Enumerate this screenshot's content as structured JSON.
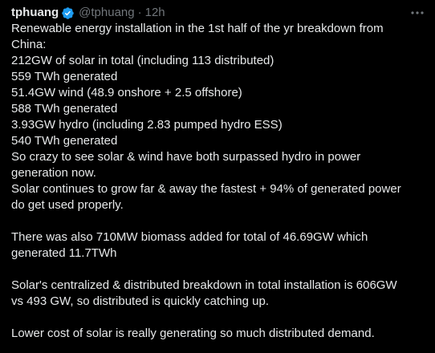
{
  "author": {
    "name": "tphuang",
    "handle": "@tphuang",
    "separator": "·",
    "timestamp": "12h",
    "verified_color": "#1d9bf0"
  },
  "more_menu_icon": "more-horizontal-icon",
  "tweet": {
    "lines": [
      "Renewable energy installation in the 1st half of the yr breakdown from",
      "China:",
      "212GW of solar in total (including 113 distributed)",
      "559 TWh generated",
      "51.4GW wind (48.9 onshore + 2.5 offshore)",
      "588 TWh generated",
      "3.93GW hydro (including 2.83 pumped hydro ESS)",
      "540 TWh generated",
      "So crazy to see solar & wind have both surpassed hydro in power",
      "generation now.",
      "Solar continues to grow far & away the fastest + 94% of generated power",
      "do get used properly.",
      "",
      "There was also 710MW biomass added for total of 46.69GW which",
      "generated 11.7TWh",
      "",
      "Solar's centralized & distributed breakdown in total installation is 606GW",
      "vs 493 GW, so distributed is quickly catching up.",
      "",
      "Lower cost of solar is really generating so much distributed demand."
    ]
  },
  "colors": {
    "background": "#000000",
    "text": "#e7e9ea",
    "muted": "#71767b",
    "accent": "#1d9bf0"
  }
}
